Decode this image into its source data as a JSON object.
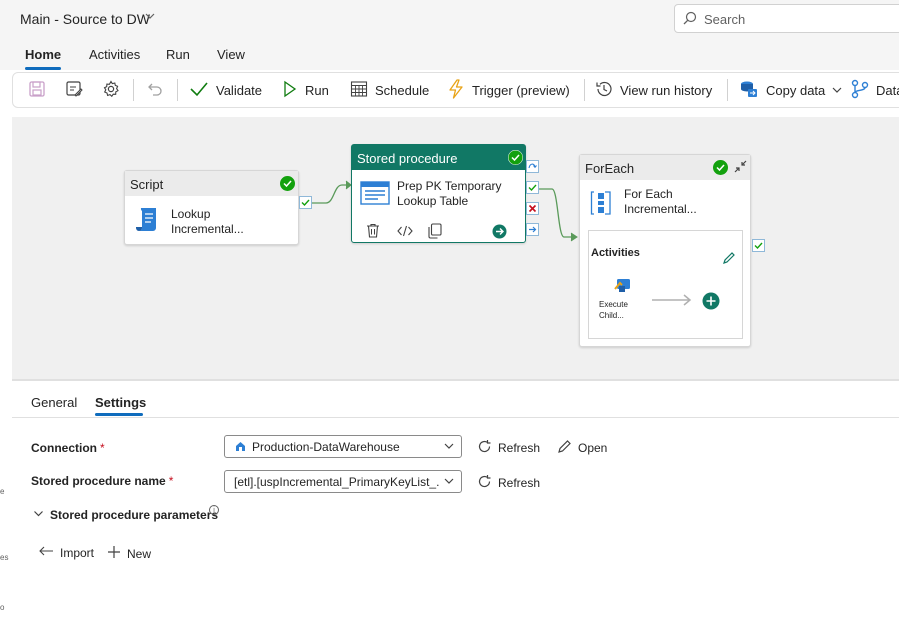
{
  "app": {
    "title": "Main - Source to DW",
    "search_placeholder": "Search"
  },
  "ribbon_tabs": [
    {
      "label": "Home",
      "active": true
    },
    {
      "label": "Activities"
    },
    {
      "label": "Run"
    },
    {
      "label": "View"
    }
  ],
  "toolbar": {
    "save_icon": "save-icon",
    "save_as_icon": "save-as-icon",
    "settings_icon": "gear-icon",
    "undo_icon": "undo-icon",
    "validate": "Validate",
    "run": "Run",
    "schedule": "Schedule",
    "trigger": "Trigger (preview)",
    "view_run_history": "View run history",
    "copy_data": "Copy data",
    "data": "Data"
  },
  "canvas": {
    "script_node": {
      "header": "Script",
      "label_line1": "Lookup",
      "label_line2": "Incremental..."
    },
    "sproc_node": {
      "header": "Stored procedure",
      "label_line1": "Prep PK Temporary",
      "label_line2": "Lookup Table"
    },
    "foreach_node": {
      "header": "ForEach",
      "label_line1": "For Each",
      "label_line2": "Incremental...",
      "activities_title": "Activities",
      "child_label_line1": "Execute",
      "child_label_line2": "Child..."
    }
  },
  "properties": {
    "tabs": [
      {
        "label": "General"
      },
      {
        "label": "Settings",
        "active": true
      }
    ],
    "connection_label": "Connection",
    "connection_value": "Production-DataWarehouse",
    "refresh": "Refresh",
    "open": "Open",
    "sproc_name_label": "Stored procedure name",
    "sproc_name_value": "[etl].[uspIncremental_PrimaryKeyList_...",
    "sproc_params_label": "Stored procedure parameters",
    "import": "Import",
    "new": "New",
    "required_mark": "*"
  },
  "left_edge_fragments": [
    "e",
    "es",
    "o"
  ],
  "colors": {
    "accent": "#0f6cbd",
    "selected_node": "#117865",
    "success": "#13a10e",
    "failure": "#c50f1f"
  }
}
